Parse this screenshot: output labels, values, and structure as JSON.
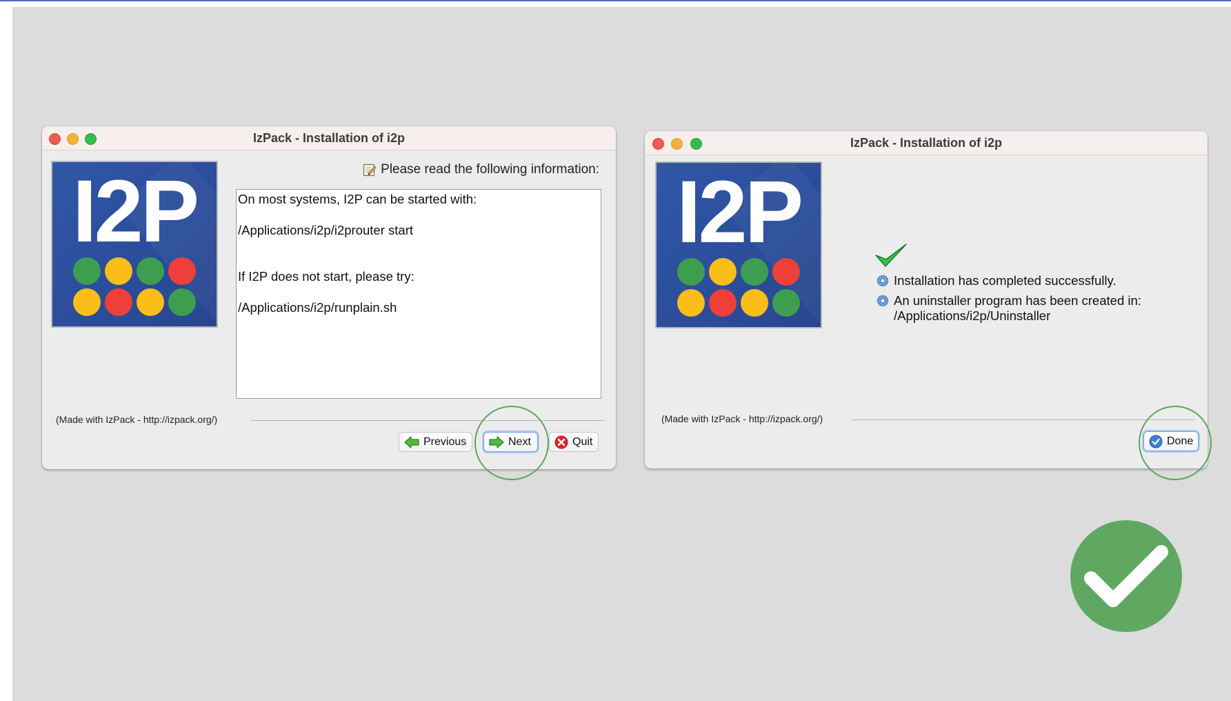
{
  "left_window": {
    "title": "IzPack - Installation of  i2p",
    "logo_text": "I2P",
    "info_header": "Please read the following information:",
    "info_lines": [
      "On most systems, I2P can be started with:",
      "/Applications/i2p/i2prouter start",
      "If I2P does not start, please try:",
      "/Applications/i2p/runplain.sh"
    ],
    "footer_text": "(Made with IzPack - http://izpack.org/)",
    "buttons": {
      "previous": "Previous",
      "next": "Next",
      "quit": "Quit"
    }
  },
  "right_window": {
    "title": "IzPack - Installation of  i2p",
    "logo_text": "I2P",
    "messages": [
      "Installation has completed successfully.",
      "An uninstaller program has been created in:",
      "/Applications/i2p/Uninstaller"
    ],
    "footer_text": "(Made with IzPack - http://izpack.org/)",
    "buttons": {
      "done": "Done"
    }
  },
  "colors": {
    "highlight_ring": "#5da55b",
    "success_badge": "#60a862",
    "logo_blue": "#2b4d9b",
    "dot_green": "#3e9e4f",
    "dot_yellow": "#fbbd18",
    "dot_red": "#ee3f38"
  },
  "icons": [
    "edit-note-icon",
    "green-arrow-left-icon",
    "green-arrow-right-icon",
    "red-x-icon",
    "blue-check-icon",
    "green-checkmark-icon",
    "gear-bullet-icon",
    "success-check-icon"
  ]
}
